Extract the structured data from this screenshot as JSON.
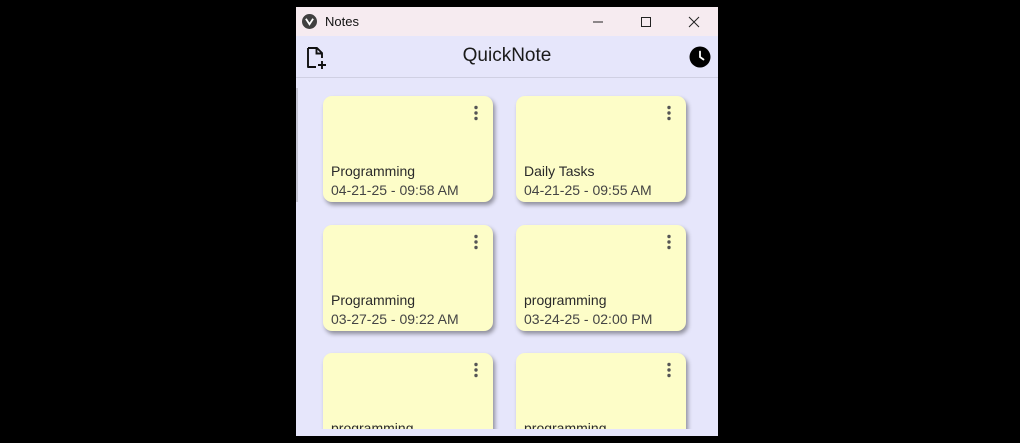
{
  "window": {
    "title": "Notes"
  },
  "appbar": {
    "title": "QuickNote"
  },
  "notes": [
    {
      "title": "Programming",
      "date": "04-21-25 - 09:58 AM"
    },
    {
      "title": "Daily Tasks",
      "date": "04-21-25 - 09:55 AM"
    },
    {
      "title": "Programming",
      "date": "03-27-25 - 09:22 AM"
    },
    {
      "title": "programming",
      "date": "03-24-25 - 02:00 PM"
    },
    {
      "title": "programming",
      "date": ""
    },
    {
      "title": "programming",
      "date": ""
    }
  ],
  "icons": {
    "new_note": "new-note-icon",
    "history": "clock-icon",
    "card_menu": "more-vertical-icon"
  },
  "colors": {
    "background": "#e6e6fb",
    "card": "#fdfdc8",
    "titlebar": "#f6ebf0"
  }
}
